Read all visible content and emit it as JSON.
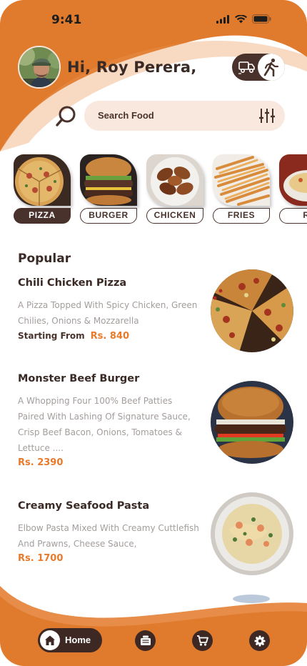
{
  "status": {
    "time": "9:41"
  },
  "header": {
    "greeting": "Hi, Roy Perera,",
    "search_placeholder": "Search Food",
    "toggle": {
      "left_icon": "delivery-truck-icon",
      "right_icon": "walking-person-icon",
      "selected": "pickup"
    }
  },
  "categories": [
    {
      "label": "PIZZA",
      "active": true
    },
    {
      "label": "BURGER",
      "active": false
    },
    {
      "label": "CHICKEN",
      "active": false
    },
    {
      "label": "FRIES",
      "active": false
    },
    {
      "label": "RI",
      "active": false
    }
  ],
  "popular": {
    "title": "Popular",
    "items": [
      {
        "name": "Chili Chicken Pizza",
        "description": "A Pizza Topped With Spicy Chicken, Green Chilies, Onions & Mozzarella",
        "price_prefix": "Starting From",
        "price": "Rs. 840"
      },
      {
        "name": "Monster Beef Burger",
        "description": "A Whopping Four 100% Beef Patties Paired With Lashing Of Signature Sauce, Crisp Beef Bacon, Onions, Tomatoes & Lettuce ....",
        "price_prefix": "",
        "price": "Rs. 2390"
      },
      {
        "name": "Creamy Seafood Pasta",
        "description": "Elbow Pasta Mixed With Creamy Cuttlefish And Prawns, Cheese Sauce,",
        "price_prefix": "",
        "price": "Rs. 1700"
      }
    ]
  },
  "nav": {
    "home_label": "Home",
    "items": [
      "home-icon",
      "menu-card-icon",
      "cart-icon",
      "settings-icon"
    ]
  },
  "colors": {
    "accent": "#e07b2e",
    "dark": "#4a322c",
    "price": "#e87a2c",
    "search_bg": "#f8e8dd"
  }
}
